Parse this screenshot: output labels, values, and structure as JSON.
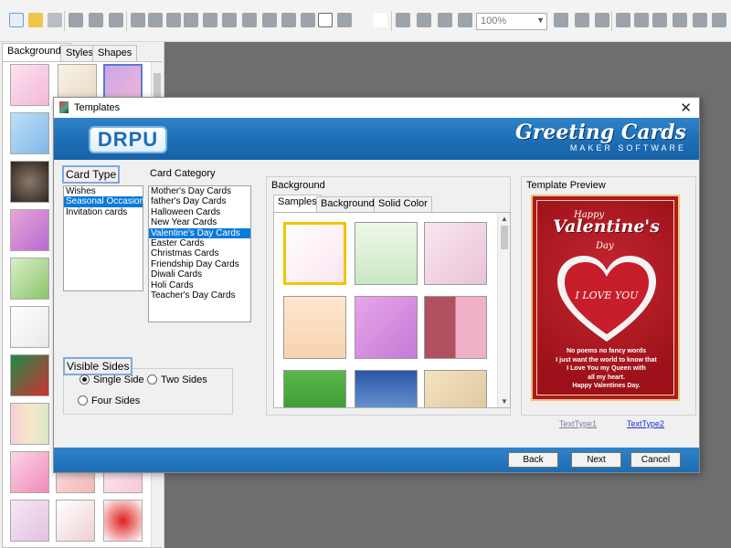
{
  "toolbar": {
    "zoom_value": "100%",
    "icons": [
      "new-icon",
      "open-icon",
      "close-icon",
      "save-icon",
      "save-as-icon",
      "print-icon",
      "print-preview-icon",
      "copy-icon",
      "cut-icon",
      "paste-icon",
      "email-icon",
      "undo-icon",
      "redo-icon",
      "zoom-icon",
      "lock-icon",
      "unlock-icon",
      "arrow-left-icon",
      "arrow-right-icon",
      "arrow-up-icon",
      "arrow-down-icon"
    ]
  },
  "left_panel": {
    "tabs": [
      "Backgrounds",
      "Styles",
      "Shapes"
    ]
  },
  "dialog": {
    "title": "Templates",
    "logo": "DRPU",
    "brand_line1": "Greeting Cards",
    "brand_line2": "MAKER SOFTWARE",
    "card_type_label": "Card Type",
    "card_types": [
      "Wishes",
      "Seasonal Occasion",
      "Invitation cards"
    ],
    "card_type_selected_index": 1,
    "card_category_label": "Card Category",
    "card_categories": [
      "Mother's Day Cards",
      "father's Day Cards",
      "Halloween Cards",
      "New Year Cards",
      "Valentine's Day Cards",
      "Easter Cards",
      "Christmas Cards",
      "Friendship Day Cards",
      "Diwali Cards",
      "Holi Cards",
      "Teacher's Day Cards"
    ],
    "card_category_selected_index": 4,
    "visible_sides_label": "Visible Sides",
    "sides_options": [
      "Single Side",
      "Two Sides",
      "Four Sides"
    ],
    "background_label": "Background",
    "background_tabs": [
      "Samples",
      "Backgrounds",
      "Solid Color"
    ],
    "template_preview_label": "Template Preview",
    "card": {
      "happy": "Happy",
      "title": "Valentine's",
      "day": "Day",
      "i_love_you": "I LOVE YOU",
      "message": [
        "No poems no fancy words",
        "I just want the world to know that",
        "I Love You my Queen with",
        "all my heart.",
        "Happy Valentines Day."
      ]
    },
    "text_type1": "TextType1",
    "text_type2": "TextType2",
    "buttons": {
      "back": "Back",
      "next": "Next",
      "cancel": "Cancel"
    },
    "close": "✕"
  },
  "colors": {
    "accent_blue": "#1d6db4",
    "selection": "#0a7ad8",
    "card_red": "#b01720"
  }
}
